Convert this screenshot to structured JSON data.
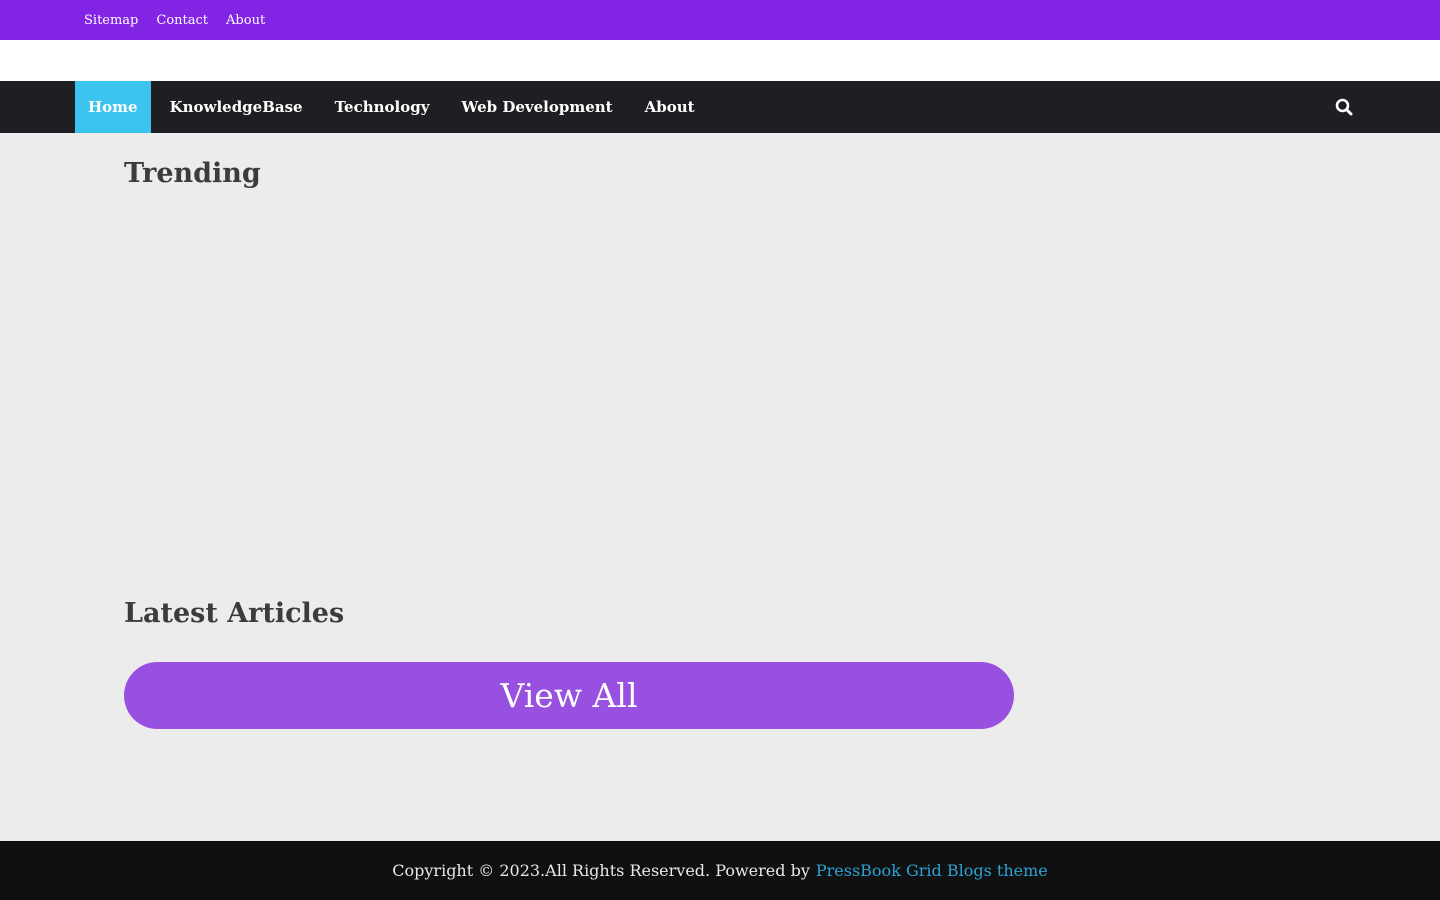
{
  "topbar": {
    "links": [
      "Sitemap",
      "Contact",
      "About"
    ]
  },
  "nav": {
    "items": [
      "Home",
      "KnowledgeBase",
      "Technology",
      "Web Development",
      "About"
    ],
    "active_index": 0,
    "search_icon": "search-icon"
  },
  "sections": {
    "trending_title": "Trending",
    "latest_title": "Latest Articles",
    "view_all_label": "View All"
  },
  "footer": {
    "copyright": "Copyright © 2023.All Rights Reserved. Powered by",
    "link_text": "PressBook Grid Blogs theme"
  },
  "colors": {
    "topbar": "#8224e3",
    "nav": "#1f1f23",
    "nav_active": "#3cc4ef",
    "view_all": "#9850e0",
    "footer_link": "#2ba3d6"
  }
}
